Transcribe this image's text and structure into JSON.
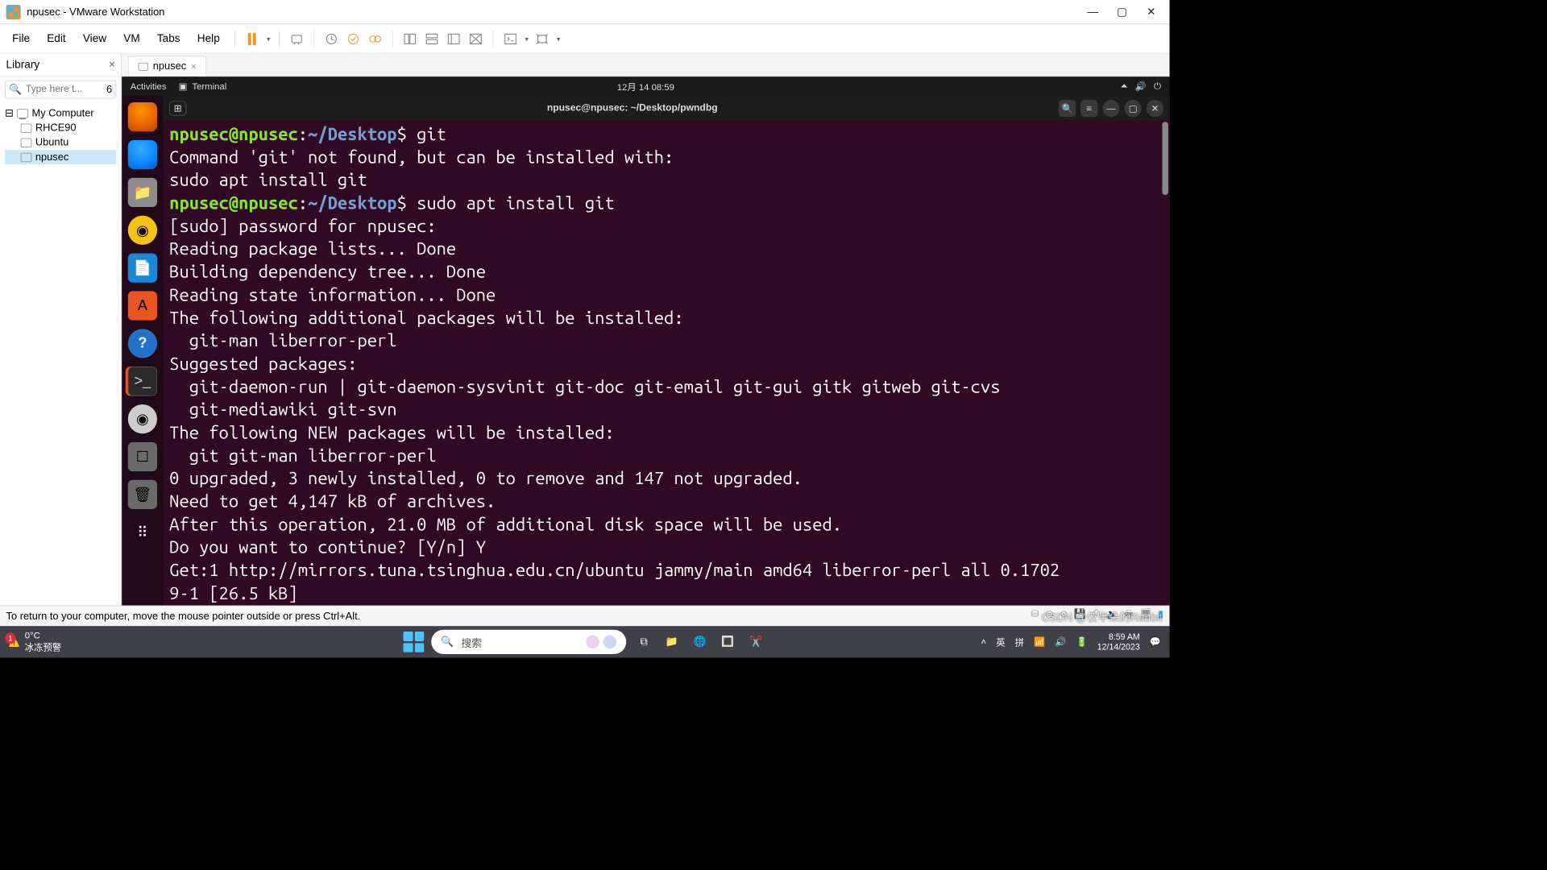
{
  "titlebar": {
    "title": "npusec - VMware Workstation"
  },
  "menu": {
    "file": "File",
    "edit": "Edit",
    "view": "View",
    "vm": "VM",
    "tabs": "Tabs",
    "help": "Help"
  },
  "library": {
    "title": "Library",
    "close": "×",
    "search_placeholder": "Type here t...",
    "search_badge": "6",
    "root": "My Computer",
    "items": [
      "RHCE90",
      "Ubuntu",
      "npusec"
    ]
  },
  "vmtab": {
    "name": "npusec",
    "close": "×"
  },
  "gnome": {
    "activities": "Activities",
    "app": "Terminal",
    "datetime": "12月 14  08:59"
  },
  "term_title": "npusec@npusec: ~/Desktop/pwndbg",
  "prompt": {
    "user": "npusec@npusec",
    "sep": ":",
    "path": "~/Desktop",
    "sym": "$ "
  },
  "cmd1": "git",
  "out1a": "Command 'git' not found, but can be installed with:",
  "out1b": "sudo apt install git",
  "cmd2": "sudo apt install git",
  "out2": "[sudo] password for npusec: ",
  "out3": "Reading package lists... Done",
  "out4": "Building dependency tree... Done",
  "out5": "Reading state information... Done",
  "out6": "The following additional packages will be installed:",
  "out7": "  git-man liberror-perl",
  "out8": "Suggested packages:",
  "out9": "  git-daemon-run | git-daemon-sysvinit git-doc git-email git-gui gitk gitweb git-cvs",
  "out10": "  git-mediawiki git-svn",
  "out11": "The following NEW packages will be installed:",
  "out12": "  git git-man liberror-perl",
  "out13": "0 upgraded, 3 newly installed, 0 to remove and 147 not upgraded.",
  "out14": "Need to get 4,147 kB of archives.",
  "out15": "After this operation, 21.0 MB of additional disk space will be used.",
  "out16": "Do you want to continue? [Y/n] Y",
  "out17": "Get:1 http://mirrors.tuna.tsinghua.edu.cn/ubuntu jammy/main amd64 liberror-perl all 0.1702",
  "out18": "9-1 [26.5 kB]",
  "statusbar": "To return to your computer, move the mouse pointer outside or press Ctrl+Alt.",
  "taskbar": {
    "temp": "0°C",
    "weather": "冰冻预警",
    "badge": "1",
    "search": "搜索",
    "ime_lang": "英",
    "ime_mode": "拼",
    "time": "8:59 AM",
    "date": "12/14/2023"
  },
  "watermark": "CSDN @仅半朵的Rabbit"
}
